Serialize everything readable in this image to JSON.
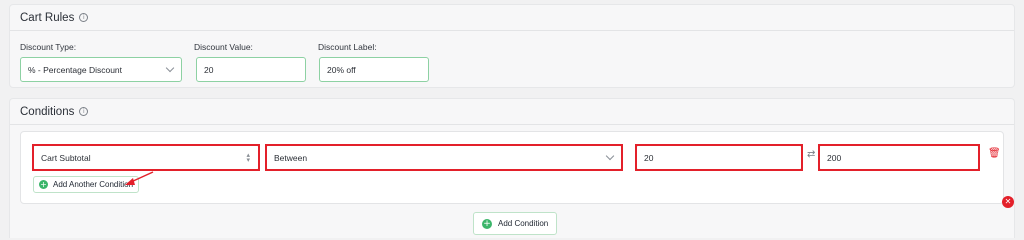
{
  "cart_rules": {
    "title": "Cart Rules",
    "discount_type": {
      "label": "Discount Type:",
      "value": "% - Percentage Discount"
    },
    "discount_value": {
      "label": "Discount Value:",
      "value": "20"
    },
    "discount_label": {
      "label": "Discount Label:",
      "value": "20% off"
    }
  },
  "conditions": {
    "title": "Conditions",
    "rows": [
      {
        "field": "Cart Subtotal",
        "operator": "Between",
        "from": "20",
        "to": "200"
      }
    ],
    "add_another_label": "Add Another Condition",
    "add_condition_label": "Add Condition"
  },
  "colors": {
    "accent": "#3bb56a",
    "highlight": "#e3202a",
    "danger": "#e3202a"
  },
  "icons": [
    "info-icon",
    "chevron-down-icon",
    "updown-icon",
    "swap-icon",
    "trash-icon",
    "plus-icon",
    "close-icon"
  ]
}
